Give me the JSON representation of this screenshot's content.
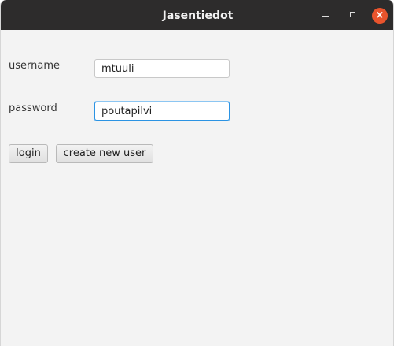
{
  "window": {
    "title": "Jasentiedot",
    "controls": {
      "minimize_icon": "minimize-icon",
      "maximize_icon": "maximize-icon",
      "close_icon": "close-icon",
      "close_glyph": "×",
      "close_color": "#e9542d"
    }
  },
  "form": {
    "username_label": "username",
    "username_value": "mtuuli",
    "password_label": "password",
    "password_value": "poutapilvi",
    "login_label": "login",
    "create_user_label": "create new user"
  },
  "colors": {
    "titlebar": "#2d2c2c",
    "background": "#f3f3f3",
    "focus": "#2b93e3"
  }
}
